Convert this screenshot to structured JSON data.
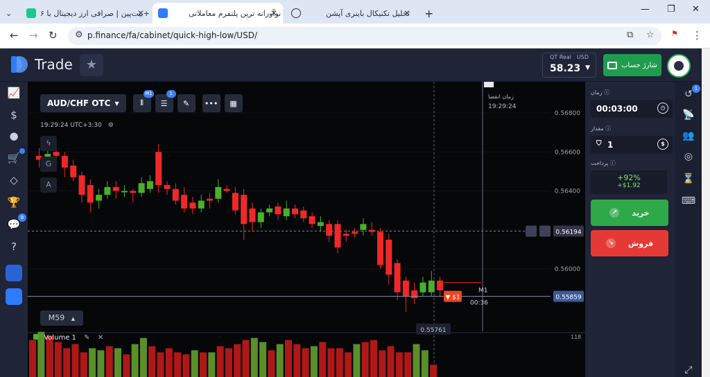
{
  "browser": {
    "tabs": [
      {
        "title": "بیت‌پین | صرافی ارز دیجیتال با ۶+",
        "active": false
      },
      {
        "title": "نوآورانه ترین پلتفرم معاملاتی",
        "active": true
      },
      {
        "title": "تحلیل تکنیکال باینری آپشن",
        "active": false
      }
    ],
    "new_tab": "+",
    "url": "p.finance/fa/cabinet/quick-high-low/USD/"
  },
  "header": {
    "logo_text": "Trade",
    "balance_label": "QT Real",
    "balance_currency": "USD",
    "balance_value": "58.23",
    "topup_label": "شارژ حساب"
  },
  "left_sidebar": {
    "badges": {
      "cart": "",
      "chat": "8"
    }
  },
  "chart_toolbar": {
    "asset": "AUD/CHF OTC",
    "indicator_badge": "M1",
    "settings_badge": "1",
    "timezone": "19:29:24 UTC+3:30",
    "side_tools": [
      "G",
      "A"
    ],
    "timeframe": "M59"
  },
  "chart_data": {
    "type": "candlestick",
    "y_ticks": [
      "0.56800",
      "0.56600",
      "0.56400",
      "0.56200",
      "0.56000"
    ],
    "ylim": [
      0.5568,
      0.5696
    ],
    "current_price": "0.55859",
    "crosshair_price": "0.56194",
    "low_label": "0.55761",
    "expiry_label": "زمان انقضا",
    "expiry_time": "19:29:24",
    "timer": "00:36",
    "timeframe_mark": "M1",
    "trade_marker": "$1",
    "candles": [
      {
        "o": 0.5658,
        "c": 0.5656,
        "h": 0.5662,
        "l": 0.5652
      },
      {
        "o": 0.5656,
        "c": 0.5659,
        "h": 0.5661,
        "l": 0.5654
      },
      {
        "o": 0.566,
        "c": 0.5658,
        "h": 0.5664,
        "l": 0.5655
      },
      {
        "o": 0.5658,
        "c": 0.5652,
        "h": 0.566,
        "l": 0.5647
      },
      {
        "o": 0.5653,
        "c": 0.5647,
        "h": 0.5656,
        "l": 0.5645
      },
      {
        "o": 0.5648,
        "c": 0.5638,
        "h": 0.565,
        "l": 0.5634
      },
      {
        "o": 0.5643,
        "c": 0.5634,
        "h": 0.5646,
        "l": 0.5629
      },
      {
        "o": 0.5635,
        "c": 0.5638,
        "h": 0.5641,
        "l": 0.5631
      },
      {
        "o": 0.5638,
        "c": 0.5642,
        "h": 0.5645,
        "l": 0.5636
      },
      {
        "o": 0.5642,
        "c": 0.564,
        "h": 0.5645,
        "l": 0.5636
      },
      {
        "o": 0.564,
        "c": 0.564,
        "h": 0.5643,
        "l": 0.5637
      },
      {
        "o": 0.564,
        "c": 0.5639,
        "h": 0.5641,
        "l": 0.5634
      },
      {
        "o": 0.5639,
        "c": 0.5644,
        "h": 0.5647,
        "l": 0.5637
      },
      {
        "o": 0.5641,
        "c": 0.5645,
        "h": 0.5648,
        "l": 0.5639
      },
      {
        "o": 0.566,
        "c": 0.5643,
        "h": 0.5664,
        "l": 0.5639
      },
      {
        "o": 0.5643,
        "c": 0.5641,
        "h": 0.5645,
        "l": 0.5638
      },
      {
        "o": 0.5641,
        "c": 0.5635,
        "h": 0.5644,
        "l": 0.5633
      },
      {
        "o": 0.5638,
        "c": 0.5631,
        "h": 0.5642,
        "l": 0.5629
      },
      {
        "o": 0.5634,
        "c": 0.5631,
        "h": 0.5637,
        "l": 0.5628
      },
      {
        "o": 0.5631,
        "c": 0.5635,
        "h": 0.5638,
        "l": 0.5629
      },
      {
        "o": 0.5636,
        "c": 0.5635,
        "h": 0.5639,
        "l": 0.5631
      },
      {
        "o": 0.5636,
        "c": 0.5642,
        "h": 0.5646,
        "l": 0.5634
      },
      {
        "o": 0.5641,
        "c": 0.564,
        "h": 0.5643,
        "l": 0.5639
      },
      {
        "o": 0.5639,
        "c": 0.563,
        "h": 0.5642,
        "l": 0.5628
      },
      {
        "o": 0.5638,
        "c": 0.5623,
        "h": 0.5641,
        "l": 0.5615
      },
      {
        "o": 0.5631,
        "c": 0.5624,
        "h": 0.5634,
        "l": 0.5619
      },
      {
        "o": 0.5624,
        "c": 0.5629,
        "h": 0.5631,
        "l": 0.5621
      },
      {
        "o": 0.5629,
        "c": 0.5631,
        "h": 0.5633,
        "l": 0.5627
      },
      {
        "o": 0.5632,
        "c": 0.5628,
        "h": 0.5634,
        "l": 0.5625
      },
      {
        "o": 0.5627,
        "c": 0.5631,
        "h": 0.5635,
        "l": 0.5625
      },
      {
        "o": 0.5631,
        "c": 0.5628,
        "h": 0.5633,
        "l": 0.5626
      },
      {
        "o": 0.563,
        "c": 0.5626,
        "h": 0.5632,
        "l": 0.5624
      },
      {
        "o": 0.5627,
        "c": 0.5623,
        "h": 0.5629,
        "l": 0.5621
      },
      {
        "o": 0.5622,
        "c": 0.5624,
        "h": 0.5627,
        "l": 0.5619
      },
      {
        "o": 0.5623,
        "c": 0.5617,
        "h": 0.5625,
        "l": 0.5614
      },
      {
        "o": 0.5623,
        "c": 0.5611,
        "h": 0.5625,
        "l": 0.5608
      },
      {
        "o": 0.5618,
        "c": 0.5617,
        "h": 0.562,
        "l": 0.5614
      },
      {
        "o": 0.5619,
        "c": 0.5618,
        "h": 0.5621,
        "l": 0.5616
      },
      {
        "o": 0.562,
        "c": 0.5623,
        "h": 0.5626,
        "l": 0.5617
      },
      {
        "o": 0.562,
        "c": 0.5619,
        "h": 0.5624,
        "l": 0.5617
      },
      {
        "o": 0.5619,
        "c": 0.5602,
        "h": 0.5621,
        "l": 0.56
      },
      {
        "o": 0.5615,
        "c": 0.5597,
        "h": 0.5618,
        "l": 0.5592
      },
      {
        "o": 0.5603,
        "c": 0.5588,
        "h": 0.5605,
        "l": 0.5584
      },
      {
        "o": 0.5594,
        "c": 0.5586,
        "h": 0.5596,
        "l": 0.5578
      },
      {
        "o": 0.5589,
        "c": 0.5585,
        "h": 0.5593,
        "l": 0.5582
      },
      {
        "o": 0.5588,
        "c": 0.5593,
        "h": 0.5596,
        "l": 0.5586
      },
      {
        "o": 0.5588,
        "c": 0.5594,
        "h": 0.5599,
        "l": 0.5586
      },
      {
        "o": 0.5594,
        "c": 0.5589,
        "h": 0.5596,
        "l": 0.5586
      }
    ],
    "volume_label": "Volume 1",
    "volume_max": "118",
    "volumes": [
      90,
      110,
      100,
      85,
      70,
      80,
      60,
      70,
      65,
      75,
      70,
      55,
      80,
      95,
      75,
      60,
      70,
      60,
      55,
      65,
      60,
      60,
      75,
      70,
      80,
      90,
      95,
      85,
      65,
      80,
      90,
      80,
      70,
      75,
      85,
      70,
      70,
      60,
      80,
      85,
      90,
      65,
      75,
      60,
      60,
      80,
      65,
      30
    ]
  },
  "trade_panel": {
    "time_label": "زمان",
    "time_value": "00:03:00",
    "amount_label": "مقدار",
    "amount_value": "1",
    "payout_label": "پرداخت",
    "payout_percent": "+92%",
    "payout_amount": "+$1.92",
    "buy_label": "خرید",
    "sell_label": "فروش"
  },
  "right_sidebar": {
    "badge": "1"
  },
  "colors": {
    "up": "#4caf2a",
    "down": "#f02828",
    "buy": "#2fa84a",
    "sell": "#e53935",
    "accent": "#3b82f6"
  }
}
